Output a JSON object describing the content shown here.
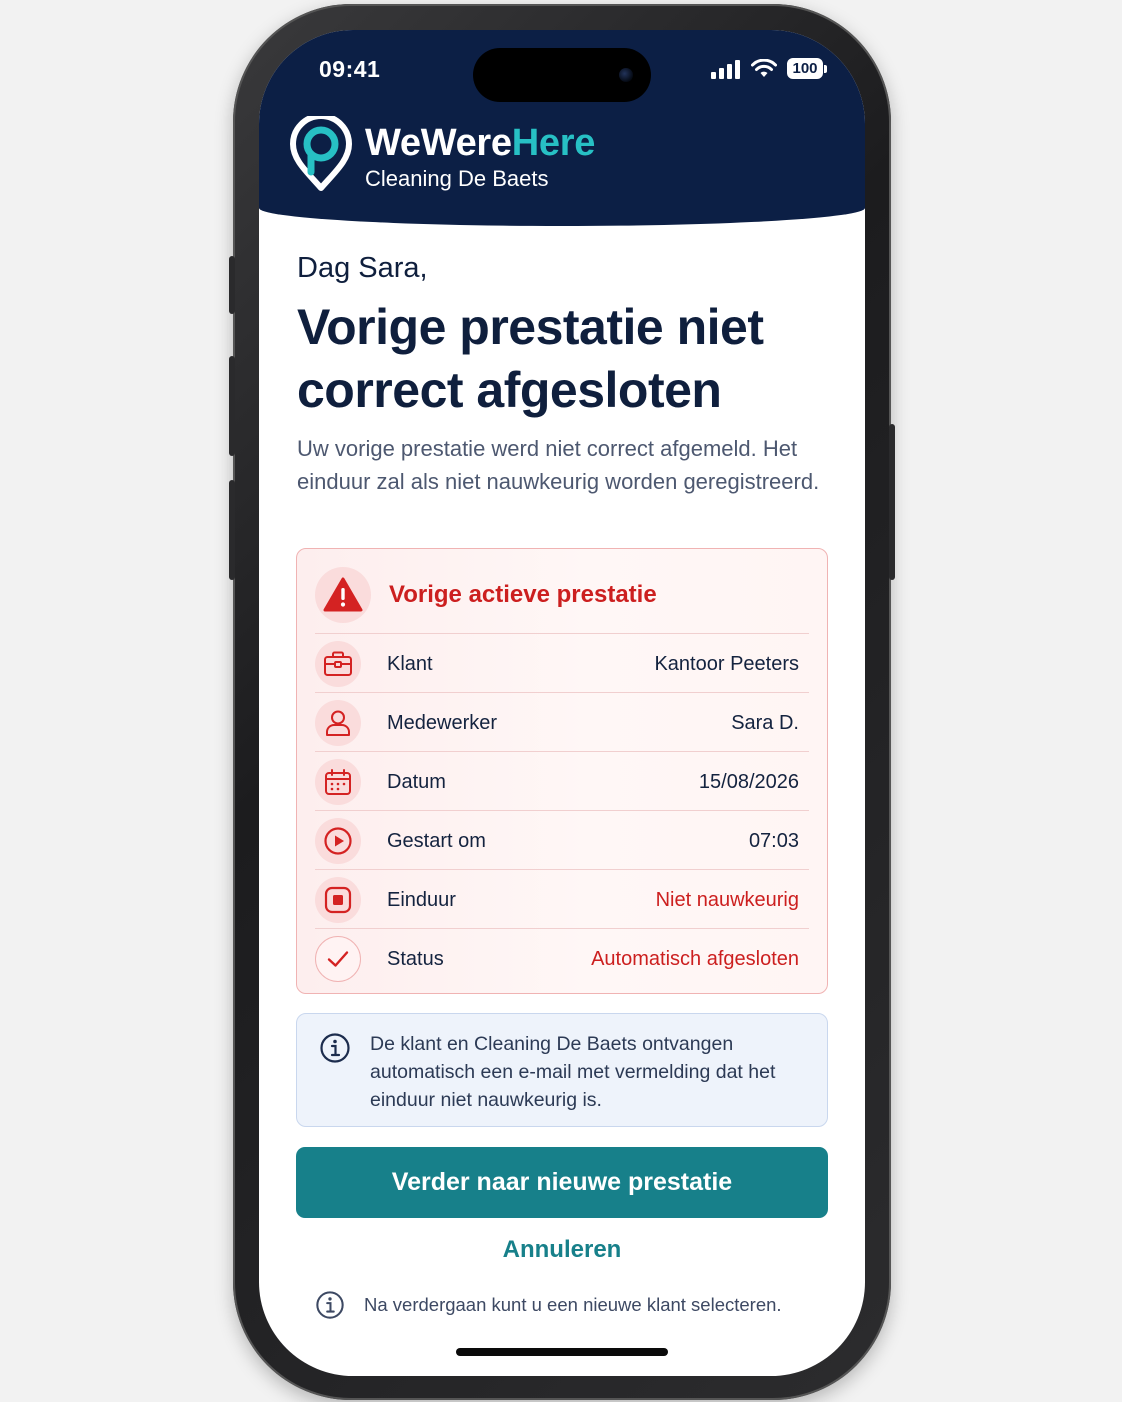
{
  "status_bar": {
    "time": "09:41",
    "battery": "100"
  },
  "header": {
    "brand_part1": "WeWere",
    "brand_part2": "Here",
    "company": "Cleaning De Baets"
  },
  "greeting": "Dag Sara,",
  "title": "Vorige prestatie niet correct afgesloten",
  "description": "Uw vorige prestatie werd niet correct afgemeld. Het einduur zal als niet nauwkeurig worden geregistreerd.",
  "card": {
    "title": "Vorige actieve prestatie",
    "rows": [
      {
        "icon": "briefcase-icon",
        "label": "Klant",
        "value": "Kantoor Peeters",
        "highlight": false
      },
      {
        "icon": "user-icon",
        "label": "Medewerker",
        "value": "Sara D.",
        "highlight": false
      },
      {
        "icon": "calendar-icon",
        "label": "Datum",
        "value": "15/08/2026",
        "highlight": false
      },
      {
        "icon": "play-circle-icon",
        "label": "Gestart om",
        "value": "07:03",
        "highlight": false
      },
      {
        "icon": "stop-circle-icon",
        "label": "Einduur",
        "value": "Niet nauwkeurig",
        "highlight": true
      },
      {
        "icon": "check-circle-icon",
        "label": "Status",
        "value": "Automatisch afgesloten",
        "highlight": true
      }
    ]
  },
  "info_text": "De klant en Cleaning De Baets ontvangen automatisch een e-mail met vermelding dat het einduur niet nauwkeurig is.",
  "primary_button": "Verder naar nieuwe prestatie",
  "cancel_link": "Annuleren",
  "footer_note": "Na verdergaan kunt u een nieuwe klant selecteren.",
  "colors": {
    "navy": "#0c1f45",
    "teal": "#17808a",
    "accent": "#27c0c4",
    "danger": "#cc1f1f"
  }
}
